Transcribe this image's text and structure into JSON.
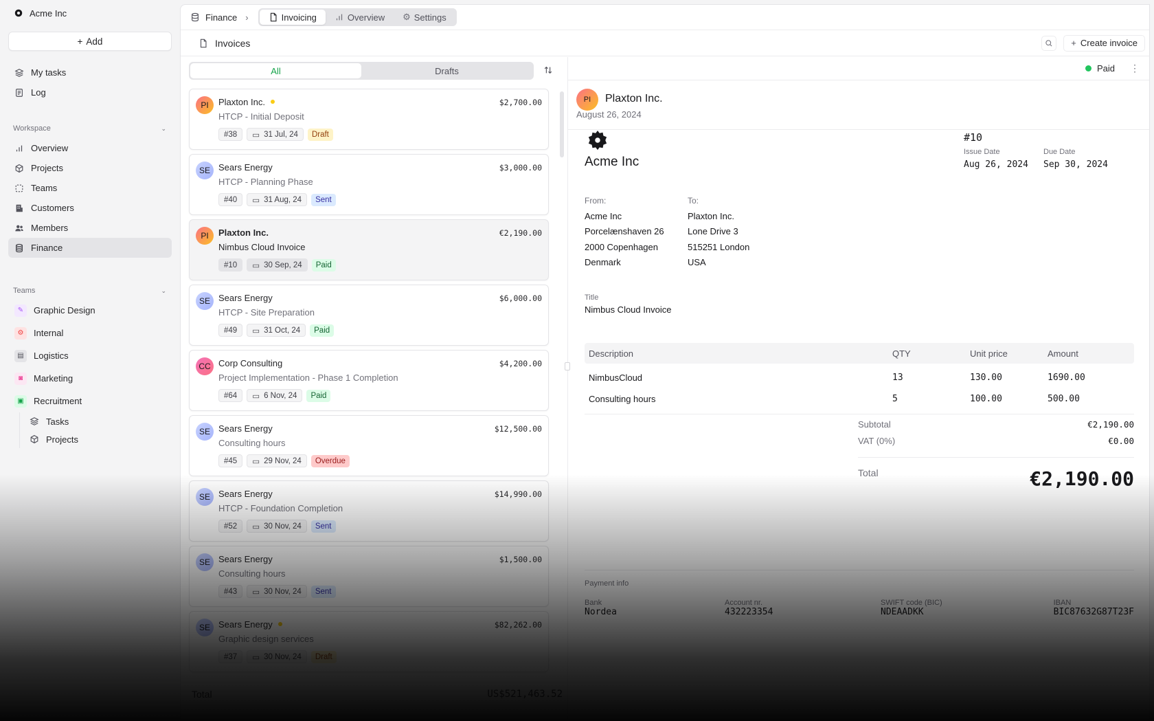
{
  "app": {
    "org": "Acme Inc",
    "add_label": "Add"
  },
  "sidebar": {
    "top": [
      {
        "label": "My tasks"
      },
      {
        "label": "Log"
      }
    ],
    "workspace_label": "Workspace",
    "workspace": [
      {
        "label": "Overview"
      },
      {
        "label": "Projects"
      },
      {
        "label": "Teams"
      },
      {
        "label": "Customers"
      },
      {
        "label": "Members"
      },
      {
        "label": "Finance"
      }
    ],
    "teams_label": "Teams",
    "teams": [
      {
        "label": "Graphic Design"
      },
      {
        "label": "Internal"
      },
      {
        "label": "Logistics"
      },
      {
        "label": "Marketing"
      },
      {
        "label": "Recruitment"
      }
    ],
    "recruitment_sub": [
      {
        "label": "Tasks"
      },
      {
        "label": "Projects"
      }
    ]
  },
  "header": {
    "breadcrumb": "Finance",
    "tabs": [
      {
        "label": "Invoicing"
      },
      {
        "label": "Overview"
      },
      {
        "label": "Settings"
      }
    ],
    "page_title": "Invoices",
    "create_label": "Create invoice"
  },
  "list": {
    "filters": [
      {
        "label": "All"
      },
      {
        "label": "Drafts"
      }
    ],
    "invoices": [
      {
        "initials": "PI",
        "customer": "Plaxton Inc.",
        "title": "HTCP - Initial Deposit",
        "amount": "$2,700.00",
        "number": "#38",
        "date": "31 Jul, 24",
        "status": "Draft"
      },
      {
        "initials": "SE",
        "customer": "Sears Energy",
        "title": "HTCP - Planning Phase",
        "amount": "$3,000.00",
        "number": "#40",
        "date": "31 Aug, 24",
        "status": "Sent"
      },
      {
        "initials": "PI",
        "customer": "Plaxton Inc.",
        "title": "Nimbus Cloud Invoice",
        "amount": "€2,190.00",
        "number": "#10",
        "date": "30 Sep, 24",
        "status": "Paid"
      },
      {
        "initials": "SE",
        "customer": "Sears Energy",
        "title": "HTCP - Site Preparation",
        "amount": "$6,000.00",
        "number": "#49",
        "date": "31 Oct, 24",
        "status": "Paid"
      },
      {
        "initials": "CC",
        "customer": "Corp Consulting",
        "title": "Project Implementation - Phase 1 Completion",
        "amount": "$4,200.00",
        "number": "#64",
        "date": "6 Nov, 24",
        "status": "Paid"
      },
      {
        "initials": "SE",
        "customer": "Sears Energy",
        "title": "Consulting hours",
        "amount": "$12,500.00",
        "number": "#45",
        "date": "29 Nov, 24",
        "status": "Overdue"
      },
      {
        "initials": "SE",
        "customer": "Sears Energy",
        "title": "HTCP - Foundation Completion",
        "amount": "$14,990.00",
        "number": "#52",
        "date": "30 Nov, 24",
        "status": "Sent"
      },
      {
        "initials": "SE",
        "customer": "Sears Energy",
        "title": "Consulting hours",
        "amount": "$1,500.00",
        "number": "#43",
        "date": "30 Nov, 24",
        "status": "Sent"
      },
      {
        "initials": "SE",
        "customer": "Sears Energy",
        "title": "Graphic design services",
        "amount": "$82,262.00",
        "number": "#37",
        "date": "30 Nov, 24",
        "status": "Draft"
      }
    ],
    "total_label": "Total",
    "total_value": "US$521,463.52"
  },
  "detail": {
    "status": "Paid",
    "customer_initials": "PI",
    "customer": "Plaxton Inc.",
    "date": "August 26, 2024",
    "company": "Acme Inc",
    "number": "#10",
    "issue_label": "Issue Date",
    "issue_date": "Aug 26, 2024",
    "due_label": "Due Date",
    "due_date": "Sep 30, 2024",
    "from_label": "From:",
    "from_lines": [
      "Acme Inc",
      "Porcelænshaven 26",
      "2000 Copenhagen",
      "Denmark"
    ],
    "to_label": "To:",
    "to_lines": [
      "Plaxton Inc.",
      "Lone Drive 3",
      "515251 London",
      "USA"
    ],
    "title_label": "Title",
    "title": "Nimbus Cloud Invoice",
    "columns": [
      "Description",
      "QTY",
      "Unit price",
      "Amount"
    ],
    "rows": [
      {
        "description": "NimbusCloud",
        "qty": "13",
        "unit_price": "130.00",
        "amount": "1690.00"
      },
      {
        "description": "Consulting hours",
        "qty": "5",
        "unit_price": "100.00",
        "amount": "500.00"
      }
    ],
    "subtotal_label": "Subtotal",
    "subtotal": "€2,190.00",
    "vat_label": "VAT (0%)",
    "vat": "€0.00",
    "total_label": "Total",
    "total": "€2,190.00",
    "payment_label": "Payment info",
    "payment": [
      {
        "label": "Bank",
        "value": "Nordea"
      },
      {
        "label": "Account nr.",
        "value": "432223354"
      },
      {
        "label": "SWIFT code (BIC)",
        "value": "NDEAADKK"
      },
      {
        "label": "IBAN",
        "value": "BIC87632G87T23F"
      }
    ]
  }
}
